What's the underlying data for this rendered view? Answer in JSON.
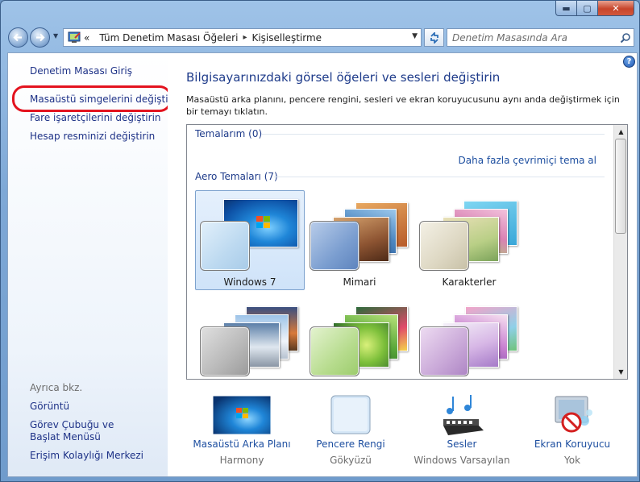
{
  "window": {
    "caption_min": "▬",
    "caption_max": "▢",
    "caption_close": "✕"
  },
  "navbar": {
    "address_prefix": "«",
    "breadcrumb": [
      "Tüm Denetim Masası Öğeleri",
      "Kişiselleştirme"
    ],
    "search_placeholder": "Denetim Masasında Ara"
  },
  "sidebar": {
    "links": [
      {
        "label": "Denetim Masası Giriş"
      },
      {
        "label": "Masaüstü simgelerini değiştirin"
      },
      {
        "label": "Fare işaretçilerini değiştirin"
      },
      {
        "label": "Hesap resminizi değiştirin"
      }
    ],
    "see_also_caption": "Ayrıca bkz.",
    "see_also": [
      {
        "label": "Görüntü"
      },
      {
        "label": "Görev Çubuğu ve Başlat Menüsü"
      },
      {
        "label": "Erişim Kolaylığı Merkezi"
      }
    ]
  },
  "main": {
    "title": "Bilgisayarınızdaki görsel öğeleri ve sesleri değiştirin",
    "description": "Masaüstü arka planını, pencere rengini, sesleri ve ekran koruyucusunu aynı anda değiştirmek için bir temayı tıklatın.",
    "my_themes_header": "Temalarım (0)",
    "more_themes_link": "Daha fazla çevrimiçi tema al",
    "aero_header": "Aero Temaları (7)",
    "themes": [
      {
        "name": "Windows 7",
        "selected": true
      },
      {
        "name": "Mimari",
        "selected": false
      },
      {
        "name": "Karakterler",
        "selected": false
      },
      {
        "name": "",
        "selected": false
      },
      {
        "name": "",
        "selected": false
      },
      {
        "name": "",
        "selected": false
      }
    ]
  },
  "options": [
    {
      "name": "Masaüstü Arka Planı",
      "value": "Harmony",
      "icon": "desktop-background-icon"
    },
    {
      "name": "Pencere Rengi",
      "value": "Gökyüzü",
      "icon": "window-color-icon"
    },
    {
      "name": "Sesler",
      "value": "Windows Varsayılan",
      "icon": "sounds-icon"
    },
    {
      "name": "Ekran Koruyucu",
      "value": "Yok",
      "icon": "screensaver-icon"
    }
  ],
  "colors": {
    "link": "#1e3287",
    "title": "#1e3b8a",
    "highlight_ring": "#e3131e"
  }
}
